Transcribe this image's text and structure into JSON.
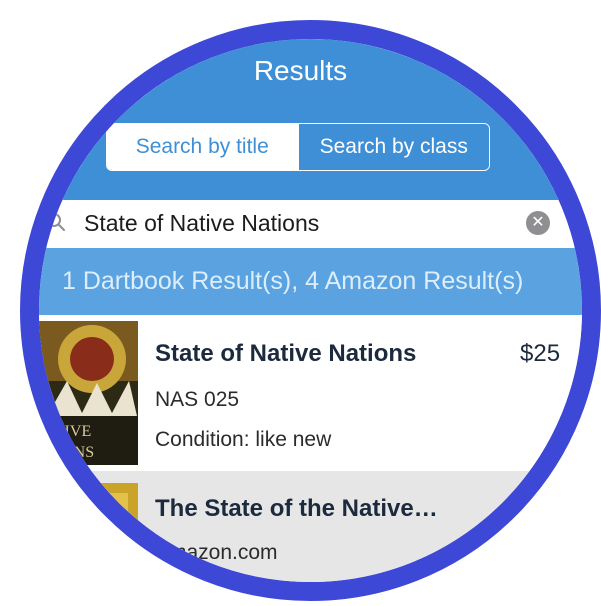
{
  "header": {
    "title": "Results"
  },
  "segment": {
    "left_label": "Search by title",
    "right_label": "Search by class"
  },
  "search": {
    "value": "State of Native Nations"
  },
  "results_banner": {
    "text": "1 Dartbook Result(s), 4 Amazon Result(s)"
  },
  "results": [
    {
      "title": "State of Native Nations",
      "course": "NAS 025",
      "condition": "Condition: like new",
      "price": "$25",
      "cover_text_1": "ATIVE",
      "cover_text_2": "TIONS"
    },
    {
      "title": "The State of the Native…",
      "source": "Amazon.com"
    }
  ],
  "colors": {
    "ring": "#3e48d6",
    "nav": "#3f8fd6",
    "banner": "#5aa2e0"
  }
}
